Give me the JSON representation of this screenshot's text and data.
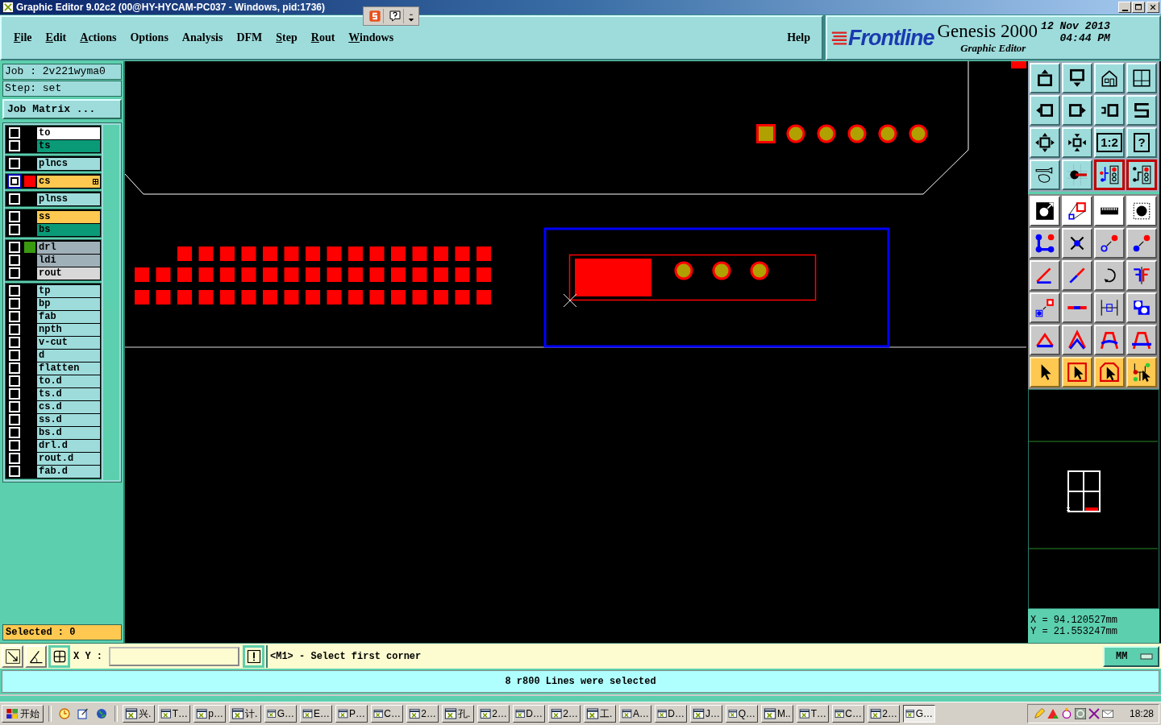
{
  "window": {
    "title": "Graphic Editor 9.02c2 (00@HY-HYCAM-PC037 - Windows, pid:1736)"
  },
  "menu": [
    {
      "label": "File",
      "mnemonic": true
    },
    {
      "label": "Edit",
      "mnemonic": true
    },
    {
      "label": "Actions",
      "mnemonic": true
    },
    {
      "label": "Options",
      "mnemonic": false
    },
    {
      "label": "Analysis",
      "mnemonic": false
    },
    {
      "label": "DFM",
      "mnemonic": false
    },
    {
      "label": "Step",
      "mnemonic": true
    },
    {
      "label": "Rout",
      "mnemonic": true
    },
    {
      "label": "Windows",
      "mnemonic": true
    }
  ],
  "help_menu": {
    "label": "Help"
  },
  "logo": {
    "brand": "Frontline",
    "product": "Genesis 2000",
    "subtitle": "Graphic Editor",
    "date": "12 Nov 2013",
    "time": "04:44 PM"
  },
  "job": "Job : 2v221wyma0",
  "step": "Step: set",
  "job_matrix_button": "Job Matrix ...",
  "layer_groups": [
    {
      "layers": [
        {
          "name": "to",
          "color": "#ffffff",
          "work": false
        },
        {
          "name": "ts",
          "color": "#0a9a78",
          "work": false
        }
      ]
    },
    {
      "layers": [
        {
          "name": "plncs",
          "color": "#9edcdc",
          "work": false
        }
      ]
    },
    {
      "layers": [
        {
          "name": "cs",
          "color": "#ffc850",
          "work": true,
          "swatch": {
            "color": "#ff0000"
          }
        }
      ]
    },
    {
      "layers": [
        {
          "name": "plnss",
          "color": "#9edcdc",
          "work": false
        }
      ]
    },
    {
      "layers": [
        {
          "name": "ss",
          "color": "#ffc850",
          "work": false
        },
        {
          "name": "bs",
          "color": "#0a9a78",
          "work": false
        }
      ]
    },
    {
      "layers": [
        {
          "name": "drl",
          "color": "#a0b0b8",
          "work": false,
          "swatch": {
            "color": "#3a9a10"
          }
        },
        {
          "name": "ldi",
          "color": "#a0b0b8",
          "work": false
        },
        {
          "name": "rout",
          "color": "#d8d8d8",
          "work": false
        }
      ]
    },
    {
      "layers": [
        {
          "name": "tp",
          "color": "#9edcdc",
          "work": false
        },
        {
          "name": "bp",
          "color": "#9edcdc",
          "work": false
        },
        {
          "name": "fab",
          "color": "#9edcdc",
          "work": false
        },
        {
          "name": "npth",
          "color": "#9edcdc",
          "work": false
        },
        {
          "name": "v-cut",
          "color": "#9edcdc",
          "work": false
        },
        {
          "name": "d",
          "color": "#9edcdc",
          "work": false
        },
        {
          "name": "flatten",
          "color": "#9edcdc",
          "work": false
        },
        {
          "name": "to.d",
          "color": "#9edcdc",
          "work": false
        },
        {
          "name": "ts.d",
          "color": "#9edcdc",
          "work": false
        },
        {
          "name": "cs.d",
          "color": "#9edcdc",
          "work": false
        },
        {
          "name": "ss.d",
          "color": "#9edcdc",
          "work": false
        },
        {
          "name": "bs.d",
          "color": "#9edcdc",
          "work": false
        },
        {
          "name": "drl.d",
          "color": "#9edcdc",
          "work": false
        },
        {
          "name": "rout.d",
          "color": "#9edcdc",
          "work": false
        },
        {
          "name": "fab.d",
          "color": "#9edcdc",
          "work": false
        }
      ]
    }
  ],
  "selected_count": "Selected : 0",
  "view_tools": [
    {
      "active": false
    },
    {
      "active": false
    },
    {
      "active": false
    },
    {
      "active": false
    },
    {
      "active": false
    },
    {
      "active": false
    },
    {
      "active": false
    },
    {
      "active": false
    },
    {
      "active": false
    },
    {
      "active": false
    },
    {
      "active": false,
      "label": "1:2"
    },
    {
      "active": false,
      "label": "?"
    },
    {
      "active": false
    },
    {
      "active": false
    },
    {
      "active": true
    },
    {
      "active": true
    }
  ],
  "coordinates": {
    "x": "X = 94.120527mm",
    "y": "Y = 21.553247mm"
  },
  "command_bar": {
    "xy_label": "X Y :",
    "prompt": "<M1> - Select first corner",
    "units": "MM"
  },
  "status_message": "8 r800 Lines were selected",
  "taskbar": {
    "start": "开始",
    "tasks": [
      {
        "label": "兴.",
        "selected": false
      },
      {
        "label": "T…",
        "selected": false
      },
      {
        "label": "p…",
        "selected": false
      },
      {
        "label": "计.",
        "selected": false
      },
      {
        "label": "G…",
        "selected": false
      },
      {
        "label": "E…",
        "selected": false
      },
      {
        "label": "P…",
        "selected": false
      },
      {
        "label": "C…",
        "selected": false
      },
      {
        "label": "2…",
        "selected": false
      },
      {
        "label": "孔.",
        "selected": false
      },
      {
        "label": "2…",
        "selected": false
      },
      {
        "label": "D…",
        "selected": false
      },
      {
        "label": "2…",
        "selected": false
      },
      {
        "label": "工.",
        "selected": false
      },
      {
        "label": "A…",
        "selected": false
      },
      {
        "label": "D…",
        "selected": false
      },
      {
        "label": "J…",
        "selected": false
      },
      {
        "label": "Q…",
        "selected": false
      },
      {
        "label": "M..",
        "selected": false
      },
      {
        "label": "T…",
        "selected": false
      },
      {
        "label": "C…",
        "selected": false
      },
      {
        "label": "2…",
        "selected": false
      },
      {
        "label": "G…",
        "selected": true
      }
    ],
    "clock": "18:28"
  }
}
